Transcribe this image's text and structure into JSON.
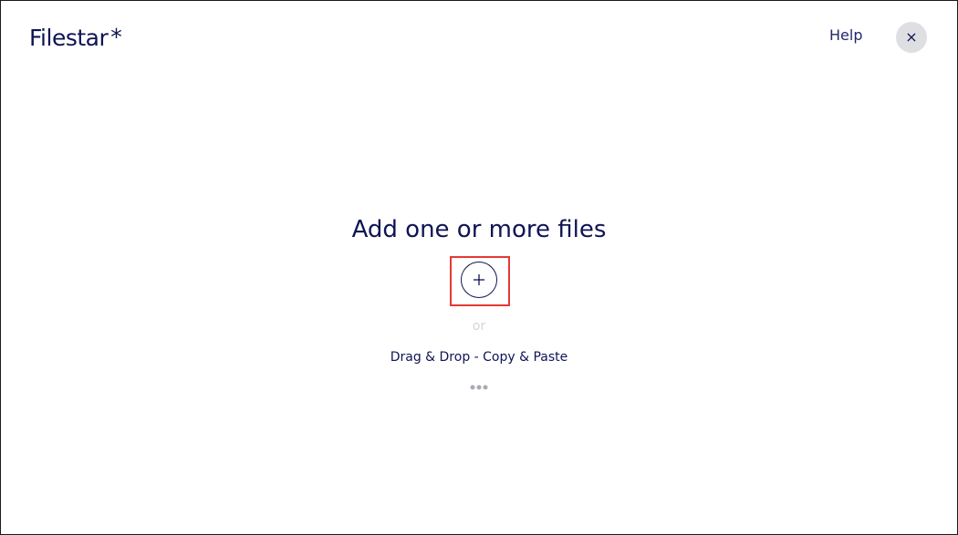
{
  "header": {
    "logo_text": "Filestar",
    "logo_star": "*",
    "help_label": "Help",
    "close_label": "×"
  },
  "main": {
    "heading": "Add one or more files",
    "or_text": "or",
    "drag_drop_text": "Drag & Drop - Copy & Paste"
  },
  "colors": {
    "brand": "#0f1454",
    "close_bg": "#dedfe2",
    "highlight": "#e53935",
    "muted": "#d3d5dc"
  },
  "icons": {
    "add": "plus-icon",
    "close": "close-icon",
    "more": "more-dots-icon"
  }
}
